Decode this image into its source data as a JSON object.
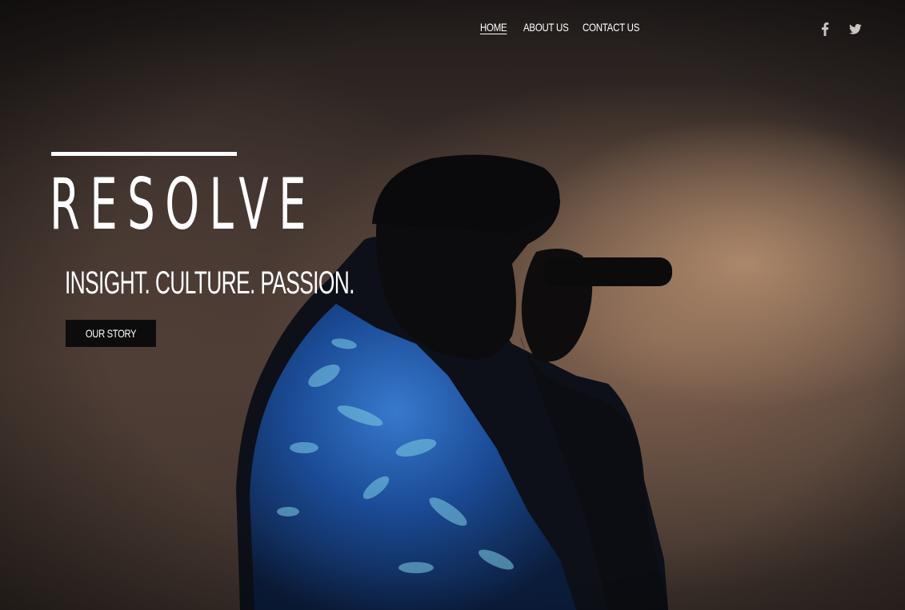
{
  "nav": {
    "items": [
      {
        "label": "HOME",
        "active": true
      },
      {
        "label": "ABOUT US",
        "active": false
      },
      {
        "label": "CONTACT US",
        "active": false
      }
    ]
  },
  "social": {
    "icons": [
      "facebook-icon",
      "twitter-icon"
    ],
    "color": "#c9c5c2"
  },
  "hero": {
    "brand": "RESOLVE",
    "tagline": "INSIGHT. CULTURE. PASSION.",
    "cta_label": "OUR STORY",
    "image_description_icon": "singer-silhouette"
  },
  "colors": {
    "text": "#ffffff",
    "button_bg": "#0d0c0c",
    "jacket_blue": "#1f56b0"
  }
}
